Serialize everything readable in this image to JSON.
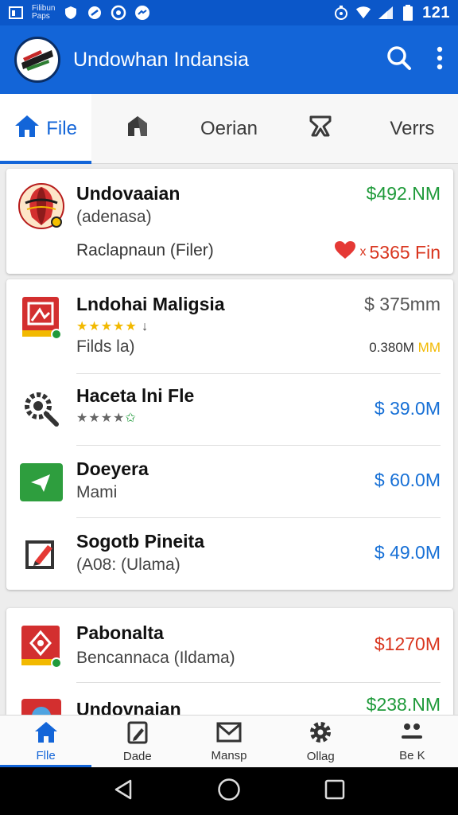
{
  "status_bar": {
    "carrier_line1": "Filibun",
    "carrier_line2": "Paps",
    "time": "121"
  },
  "app_bar": {
    "title": "Undowhan Indansia"
  },
  "tabs": [
    {
      "label": "File",
      "icon": "home-icon",
      "active": true
    },
    {
      "label": "",
      "icon": "shield-icon",
      "active": false
    },
    {
      "label": "Oerian",
      "icon": "",
      "active": false
    },
    {
      "label": "",
      "icon": "flag-icon",
      "active": false
    },
    {
      "label": "Verrs",
      "icon": "",
      "active": false
    }
  ],
  "cards": {
    "featured": {
      "title": "Undovaaian",
      "subtitle": "(adenasa)",
      "price": "$492.NM",
      "meta": "Raclapnaun (Filer)",
      "stat": "5365 Fin",
      "stat_prefix": "x"
    },
    "list": [
      {
        "title": "Lndohai Maligsia",
        "rating": "★★★★★",
        "rating_tail": "↓",
        "sub": "Filds la)",
        "price": "$ 375mm",
        "price_small_a": "0.380M",
        "price_small_b": "MM"
      },
      {
        "title": "Haceta lni Fle",
        "rating": "★★★★",
        "rating_tail": "✩",
        "price": "$ 39.0M"
      },
      {
        "title": "Doeyera",
        "sub": "Mami",
        "price": "$ 60.0M"
      },
      {
        "title": "Sogotb Pineita",
        "sub": "(A08: (Ulama)",
        "price": "$ 49.0M"
      }
    ],
    "bottom": [
      {
        "title": "Pabonalta",
        "sub": "Bencannaca (Ildama)",
        "price": "$1270M"
      },
      {
        "title": "Undovnaian",
        "price": "$238.NM"
      }
    ]
  },
  "bottom_nav": [
    {
      "label": "Flle",
      "icon": "home-icon",
      "active": true
    },
    {
      "label": "Dade",
      "icon": "document-edit-icon",
      "active": false
    },
    {
      "label": "Mansp",
      "icon": "mail-icon",
      "active": false
    },
    {
      "label": "Ollag",
      "icon": "gear-icon",
      "active": false
    },
    {
      "label": "Be K",
      "icon": "people-icon",
      "active": false
    }
  ],
  "colors": {
    "primary": "#1365d8",
    "status": "#0b57c9",
    "positive": "#1f9a3a",
    "negative": "#d9361f",
    "link": "#1770d6"
  }
}
